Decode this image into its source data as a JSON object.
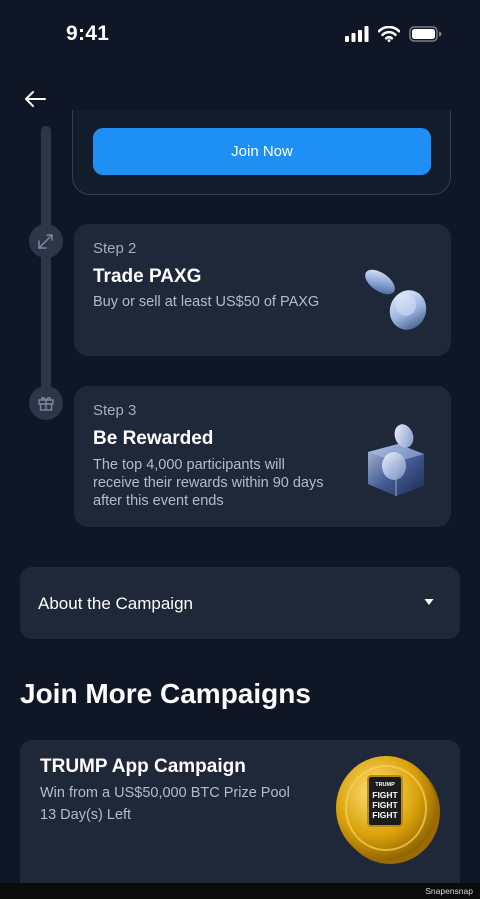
{
  "status_bar": {
    "time": "9:41"
  },
  "header": {
    "back_icon": "arrow-left-icon"
  },
  "step1": {
    "join_button_label": "Join Now"
  },
  "steps": [
    {
      "label": "Step 2",
      "title": "Trade PAXG",
      "description": "Buy or sell at least US$50 of PAXG",
      "node_icon": "swap-arrows-icon",
      "art": "coins-illustration"
    },
    {
      "label": "Step 3",
      "title": "Be Rewarded",
      "description_lines": [
        "The top 4,000 participants will",
        "receive their rewards within 90 days",
        "after this event ends"
      ],
      "node_icon": "gift-icon",
      "art": "reward-box-illustration"
    }
  ],
  "about": {
    "label": "About the Campaign",
    "caret_icon": "caret-down-icon"
  },
  "more": {
    "title": "Join More Campaigns",
    "campaign": {
      "title": "TRUMP App Campaign",
      "subtitle": "Win from a US$50,000 BTC Prize Pool",
      "days_left": "13 Day(s) Left",
      "coin_text": [
        "TRUMP",
        "FIGHT",
        "FIGHT",
        "FIGHT"
      ]
    }
  },
  "watermark": "Snapensnap",
  "colors": {
    "background": "#0f1726",
    "card": "#1e2839",
    "accent": "#1e90f5",
    "timeline": "#2c3648"
  }
}
